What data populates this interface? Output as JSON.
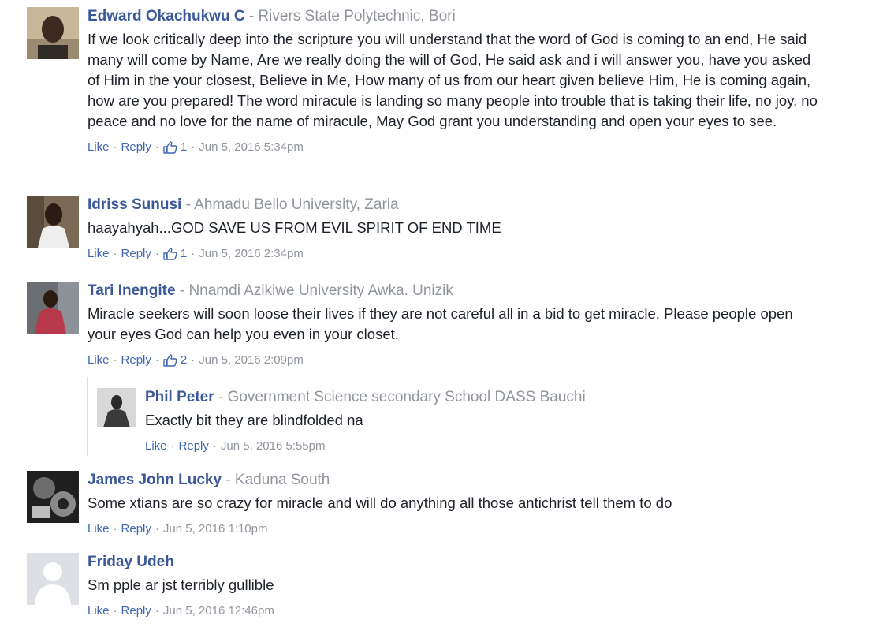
{
  "comments": [
    {
      "name": "Edward Okachukwu C",
      "affiliation": "Rivers State Polytechnic, Bori",
      "text": "If we look critically deep into the scripture you will understand that the word of God is coming to an end, He said many will come by Name, Are we really doing the will of God, He said ask and i will answer you, have you asked of Him in the your closest, Believe in Me, How many of us from our heart given believe Him, He is coming again, how are you prepared! The word miracule is landing so many people into trouble that is taking their life, no joy, no peace and no love for the name of miracule, May God grant you understanding and open your eyes to see.",
      "like_label": "Like",
      "reply_label": "Reply",
      "likes": "1",
      "timestamp": "Jun 5, 2016 5:34pm"
    },
    {
      "name": "Idriss Sunusi",
      "affiliation": "Ahmadu Bello University, Zaria",
      "text": "haayahyah...GOD SAVE US FROM EVIL SPIRIT OF END TIME",
      "like_label": "Like",
      "reply_label": "Reply",
      "likes": "1",
      "timestamp": "Jun 5, 2016 2:34pm"
    },
    {
      "name": "Tari Inengite",
      "affiliation": "Nnamdi Azikiwe University Awka. Unizik",
      "text": "Miracle seekers will soon loose their lives if they are not careful all in a bid to get miracle. Please people open your eyes God can help you even in your closet.",
      "like_label": "Like",
      "reply_label": "Reply",
      "likes": "2",
      "timestamp": "Jun 5, 2016 2:09pm"
    },
    {
      "name": "Phil Peter",
      "affiliation": "Government Science secondary School DASS Bauchi",
      "text": "Exactly bit they are blindfolded na",
      "like_label": "Like",
      "reply_label": "Reply",
      "timestamp": "Jun 5, 2016 5:55pm"
    },
    {
      "name": "James John Lucky",
      "affiliation": "Kaduna South",
      "text": "Some xtians are so crazy for miracle and will do anything all those antichrist tell them to do",
      "like_label": "Like",
      "reply_label": "Reply",
      "timestamp": "Jun 5, 2016 1:10pm"
    },
    {
      "name": "Friday Udeh",
      "affiliation": "",
      "text": "Sm pple ar jst terribly gullible",
      "like_label": "Like",
      "reply_label": "Reply",
      "timestamp": "Jun 5, 2016 12:46pm"
    }
  ],
  "separator": "·",
  "icons": {
    "like_count": "thumbs-up-icon"
  },
  "colors": {
    "name": "#3b5998",
    "link": "#4267b2",
    "meta": "#90949c"
  }
}
